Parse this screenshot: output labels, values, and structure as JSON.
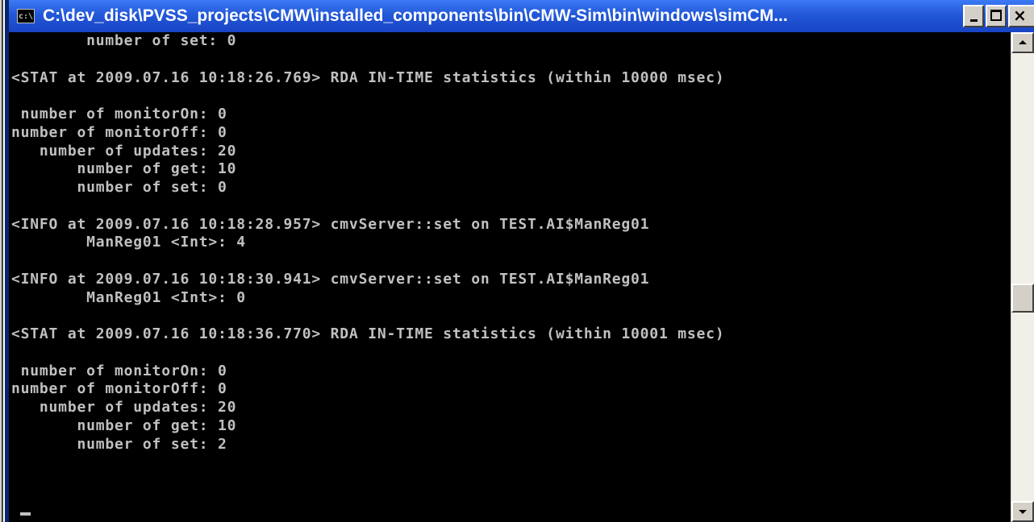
{
  "window": {
    "title": "C:\\dev_disk\\PVSS_projects\\CMW\\installed_components\\bin\\CMW-Sim\\bin\\windows\\simCM...",
    "app_icon": "c:\\",
    "app_icon_name": "console-icon"
  },
  "title_buttons": {
    "minimize": "minimize",
    "maximize": "maximize",
    "close": "×"
  },
  "console": {
    "lines": [
      "        number of set: 0",
      "",
      "<STAT at 2009.07.16 10:18:26.769> RDA IN-TIME statistics (within 10000 msec)",
      "",
      " number of monitorOn: 0",
      "number of monitorOff: 0",
      "   number of updates: 20",
      "       number of get: 10",
      "       number of set: 0",
      "",
      "<INFO at 2009.07.16 10:18:28.957> cmvServer::set on TEST.AI$ManReg01",
      "        ManReg01 <Int>: 4",
      "",
      "<INFO at 2009.07.16 10:18:30.941> cmvServer::set on TEST.AI$ManReg01",
      "        ManReg01 <Int>: 0",
      "",
      "<STAT at 2009.07.16 10:18:36.770> RDA IN-TIME statistics (within 10001 msec)",
      "",
      " number of monitorOn: 0",
      "number of monitorOff: 0",
      "   number of updates: 20",
      "       number of get: 10",
      "       number of set: 2",
      "",
      ""
    ]
  },
  "colors": {
    "title_bar": "#2258d8",
    "console_bg": "#000000",
    "console_text": "#c0c0c0"
  },
  "scrollbar": {
    "position_fraction": 0.55
  }
}
